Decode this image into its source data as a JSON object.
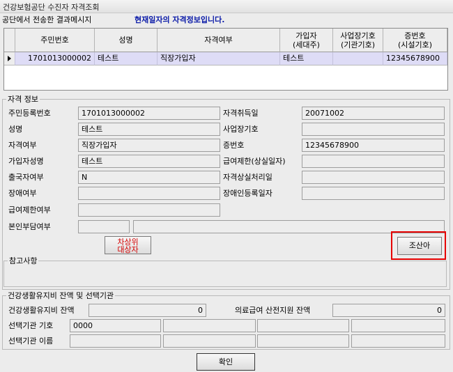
{
  "window": {
    "title": "건강보험공단 수진자 자격조회"
  },
  "message": {
    "label": "공단에서 전송한 결과메시지",
    "text": "현재일자의 자격정보입니다."
  },
  "grid": {
    "headers": [
      "주민번호",
      "성명",
      "자격여부",
      "가입자\n(세대주)",
      "사업장기호\n(기관기호)",
      "증번호\n(시설기호)"
    ],
    "rows": [
      [
        "1701013000002",
        "테스트",
        "직장가입자",
        "테스트",
        "",
        "12345678900"
      ]
    ]
  },
  "qual": {
    "title": "자격 정보",
    "fields": {
      "rrn": {
        "label": "주민등록번호",
        "value": "1701013000002"
      },
      "acq_date": {
        "label": "자격취득일",
        "value": "20071002"
      },
      "name": {
        "label": "성명",
        "value": "테스트"
      },
      "biz_code": {
        "label": "사업장기호",
        "value": ""
      },
      "qual_type": {
        "label": "자격여부",
        "value": "직장가입자"
      },
      "card_no": {
        "label": "증번호",
        "value": "12345678900"
      },
      "member_name": {
        "label": "가입자성명",
        "value": "테스트"
      },
      "benefit_limit": {
        "label": "급여제한(상실일자)",
        "value": ""
      },
      "emigrant": {
        "label": "출국자여부",
        "value": "N"
      },
      "loss_date": {
        "label": "자격상실처리일",
        "value": ""
      },
      "disabled": {
        "label": "장애여부",
        "value": ""
      },
      "disabled_date": {
        "label": "장애인등록일자",
        "value": ""
      },
      "benefit_limit_yn": {
        "label": "급여제한여부",
        "value": ""
      },
      "copay": {
        "label": "본인부담여부",
        "value": ""
      }
    },
    "buttons": {
      "upper": "차상위\n대상자",
      "lookup": "조산아"
    },
    "highlight_color": "#e60000"
  },
  "notes": {
    "title": "참고사항",
    "value": ""
  },
  "welfare": {
    "title": "건강생활유지비 잔액 및 선택기관",
    "balance": {
      "label": "건강생활유지비 잔액",
      "value": "0"
    },
    "medical_aid": {
      "label": "의료급여 산전지원 잔액",
      "value": "0"
    },
    "inst_code": {
      "label": "선택기관 기호",
      "values": [
        "0000",
        "",
        "",
        ""
      ]
    },
    "inst_name": {
      "label": "선택기관 이름",
      "values": [
        "",
        "",
        "",
        ""
      ]
    }
  },
  "footer": {
    "ok_label": "확인"
  },
  "colors": {
    "row_selected": "#dedcf6",
    "message_text": "#0a1aa8"
  }
}
